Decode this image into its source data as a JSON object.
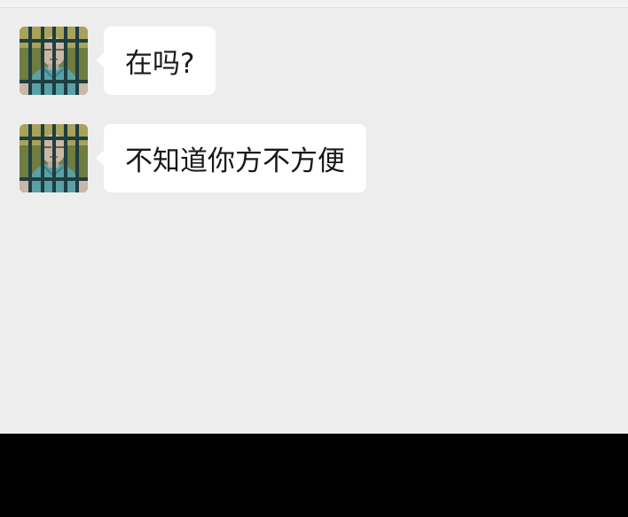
{
  "conversation": {
    "messages": [
      {
        "sender_avatar_icon": "prisoner-avatar-icon",
        "text": "在吗?"
      },
      {
        "sender_avatar_icon": "prisoner-avatar-icon",
        "text": "不知道你方不方便"
      }
    ]
  },
  "colors": {
    "chat_background": "#ededed",
    "bubble_background": "#ffffff",
    "text": "#191919",
    "bottom_bar": "#000000"
  }
}
